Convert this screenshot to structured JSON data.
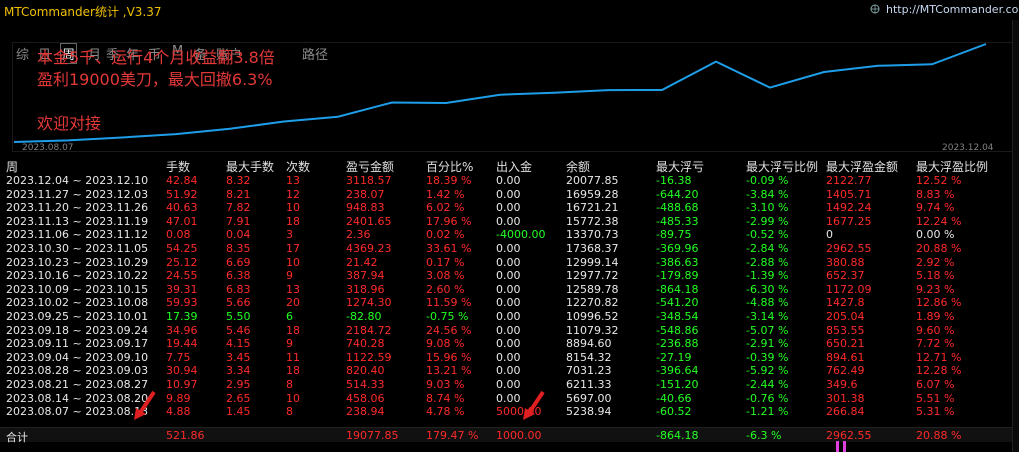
{
  "window": {
    "title": "MTCommander统计 ,V3.37",
    "url": "http://MTCommander.com"
  },
  "tabs": [
    {
      "label": "综",
      "active": false
    },
    {
      "label": "日",
      "active": false
    },
    {
      "label": "周",
      "active": true
    },
    {
      "label": "月",
      "active": false
    },
    {
      "label": "季",
      "active": false
    },
    {
      "label": "年",
      "active": false
    },
    {
      "label": "币",
      "active": false
    },
    {
      "label": "M",
      "active": false
    },
    {
      "label": "备",
      "active": false
    },
    {
      "label": "账户",
      "active": false
    },
    {
      "label": "路径",
      "active": false
    }
  ],
  "annotations": {
    "line1": "本金5千、运行4个月收益翻3.8倍",
    "line2": "盈利19000美刀，最大回撤6.3%",
    "line3": "欢迎对接"
  },
  "chart_data": {
    "type": "line",
    "x_start_label": "2023.08.07",
    "x_end_label": "2023.12.04",
    "color": "#1e9ee8",
    "categories": [
      "2023.08.07",
      "2023.08.14",
      "2023.08.21",
      "2023.08.28",
      "2023.09.04",
      "2023.09.11",
      "2023.09.18",
      "2023.09.25",
      "2023.10.02",
      "2023.10.09",
      "2023.10.16",
      "2023.10.23",
      "2023.10.30",
      "2023.11.06",
      "2023.11.13",
      "2023.11.20",
      "2023.11.27",
      "2023.12.04"
    ],
    "values": [
      5000,
      5238.94,
      5697.0,
      6211.33,
      7031.23,
      8154.32,
      8894.6,
      11079.32,
      10996.52,
      12270.82,
      12589.78,
      12977.72,
      12999.14,
      17368.37,
      13370.73,
      15772.38,
      16721.21,
      16959.28,
      20077.85
    ]
  },
  "table": {
    "headers": [
      "周",
      "手数",
      "最大手数",
      "次数",
      "盈亏金额",
      "百分比%",
      "出入金",
      "余额",
      "最大浮亏",
      "最大浮亏比例",
      "最大浮盈金额",
      "最大浮盈比例"
    ],
    "rows": [
      [
        "2023.12.04 ~ 2023.12.10",
        "42.84",
        "8.32",
        "13",
        "3118.57",
        "18.39 %",
        "0.00",
        "20077.85",
        "-16.38",
        "-0.09 %",
        "2122.77",
        "12.52 %"
      ],
      [
        "2023.11.27 ~ 2023.12.03",
        "51.92",
        "8.21",
        "12",
        "238.07",
        "1.42 %",
        "0.00",
        "16959.28",
        "-644.20",
        "-3.84 %",
        "1405.71",
        "8.83 %"
      ],
      [
        "2023.11.20 ~ 2023.11.26",
        "40.63",
        "7.82",
        "10",
        "948.83",
        "6.02 %",
        "0.00",
        "16721.21",
        "-488.68",
        "-3.10 %",
        "1492.24",
        "9.74 %"
      ],
      [
        "2023.11.13 ~ 2023.11.19",
        "47.01",
        "7.91",
        "18",
        "2401.65",
        "17.96 %",
        "0.00",
        "15772.38",
        "-485.33",
        "-2.99 %",
        "1677.25",
        "12.24 %"
      ],
      [
        "2023.11.06 ~ 2023.11.12",
        "0.08",
        "0.04",
        "3",
        "2.36",
        "0.02 %",
        "-4000.00",
        "13370.73",
        "-89.75",
        "-0.52 %",
        "0",
        "0.00 %"
      ],
      [
        "2023.10.30 ~ 2023.11.05",
        "54.25",
        "8.35",
        "17",
        "4369.23",
        "33.61 %",
        "0.00",
        "17368.37",
        "-369.96",
        "-2.84 %",
        "2962.55",
        "20.88 %"
      ],
      [
        "2023.10.23 ~ 2023.10.29",
        "25.12",
        "6.69",
        "10",
        "21.42",
        "0.17 %",
        "0.00",
        "12999.14",
        "-386.63",
        "-2.88 %",
        "380.88",
        "2.92 %"
      ],
      [
        "2023.10.16 ~ 2023.10.22",
        "24.55",
        "6.38",
        "9",
        "387.94",
        "3.08 %",
        "0.00",
        "12977.72",
        "-179.89",
        "-1.39 %",
        "652.37",
        "5.18 %"
      ],
      [
        "2023.10.09 ~ 2023.10.15",
        "39.31",
        "6.83",
        "13",
        "318.96",
        "2.60 %",
        "0.00",
        "12589.78",
        "-864.18",
        "-6.30 %",
        "1172.09",
        "9.23 %"
      ],
      [
        "2023.10.02 ~ 2023.10.08",
        "59.93",
        "5.66",
        "20",
        "1274.30",
        "11.59 %",
        "0.00",
        "12270.82",
        "-541.20",
        "-4.88 %",
        "1427.8",
        "12.86 %"
      ],
      [
        "2023.09.25 ~ 2023.10.01",
        "17.39",
        "5.50",
        "6",
        "-82.80",
        "-0.75 %",
        "0.00",
        "10996.52",
        "-348.54",
        "-3.14 %",
        "205.04",
        "1.89 %"
      ],
      [
        "2023.09.18 ~ 2023.09.24",
        "34.96",
        "5.46",
        "18",
        "2184.72",
        "24.56 %",
        "0.00",
        "11079.32",
        "-548.86",
        "-5.07 %",
        "853.55",
        "9.60 %"
      ],
      [
        "2023.09.11 ~ 2023.09.17",
        "19.44",
        "4.15",
        "9",
        "740.28",
        "9.08 %",
        "0.00",
        "8894.60",
        "-236.88",
        "-2.91 %",
        "650.21",
        "7.72 %"
      ],
      [
        "2023.09.04 ~ 2023.09.10",
        "7.75",
        "3.45",
        "11",
        "1122.59",
        "15.96 %",
        "0.00",
        "8154.32",
        "-27.19",
        "-0.39 %",
        "894.61",
        "12.71 %"
      ],
      [
        "2023.08.28 ~ 2023.09.03",
        "30.94",
        "3.34",
        "18",
        "820.40",
        "13.21 %",
        "0.00",
        "7031.23",
        "-396.64",
        "-5.92 %",
        "762.49",
        "12.28 %"
      ],
      [
        "2023.08.21 ~ 2023.08.27",
        "10.97",
        "2.95",
        "8",
        "514.33",
        "9.03 %",
        "0.00",
        "6211.33",
        "-151.20",
        "-2.44 %",
        "349.6",
        "6.07 %"
      ],
      [
        "2023.08.14 ~ 2023.08.20",
        "9.89",
        "2.65",
        "10",
        "458.06",
        "8.74 %",
        "0.00",
        "5697.00",
        "-40.66",
        "-0.76 %",
        "301.38",
        "5.51 %"
      ],
      [
        "2023.08.07 ~ 2023.08.13",
        "4.88",
        "1.45",
        "8",
        "238.94",
        "4.78 %",
        "5000.00",
        "5238.94",
        "-60.52",
        "-1.21 %",
        "266.84",
        "5.31 %"
      ]
    ],
    "total": [
      "合计",
      "521.86",
      "",
      "",
      "19077.85",
      "179.47 %",
      "1000.00",
      "",
      "-864.18",
      "-6.3 %",
      "2962.55",
      "20.88 %"
    ]
  }
}
